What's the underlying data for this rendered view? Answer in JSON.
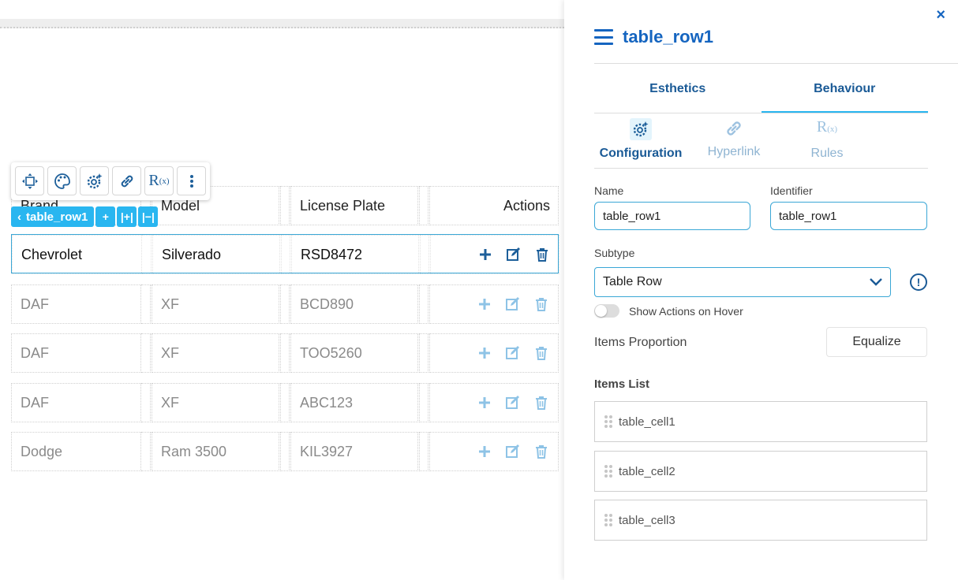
{
  "table": {
    "headers": [
      "Brand",
      "Model",
      "License Plate",
      "Actions"
    ],
    "rows": [
      {
        "brand": "Chevrolet",
        "model": "Silverado",
        "plate": "RSD8472"
      },
      {
        "brand": "DAF",
        "model": "XF",
        "plate": "BCD890"
      },
      {
        "brand": "DAF",
        "model": "XF",
        "plate": "TOO5260"
      },
      {
        "brand": "DAF",
        "model": "XF",
        "plate": "ABC123"
      },
      {
        "brand": "Dodge",
        "model": "Ram 3500",
        "plate": "KIL3927"
      }
    ]
  },
  "floating_toolbar": {
    "icons": [
      "move-icon",
      "palette-icon",
      "settings-sparkle-icon",
      "link-icon",
      "rules-icon",
      "more-vertical-icon"
    ],
    "rules_glyph": "R",
    "rules_sub": "(x)"
  },
  "selection_tag": {
    "back": "‹",
    "label": "table_row1",
    "add": "+",
    "insert": "|+|",
    "remove": "|−|"
  },
  "panel": {
    "close": "×",
    "title": "table_row1",
    "tabs": [
      "Esthetics",
      "Behaviour"
    ],
    "subtabs": [
      "Configuration",
      "Hyperlink",
      "Rules"
    ],
    "name_label": "Name",
    "name_value": "table_row1",
    "identifier_label": "Identifier",
    "identifier_value": "table_row1",
    "subtype_label": "Subtype",
    "subtype_value": "Table Row",
    "info": "!",
    "show_actions_label": "Show Actions on Hover",
    "items_proportion_label": "Items Proportion",
    "equalize_label": "Equalize",
    "items_list_label": "Items List",
    "items": [
      "table_cell1",
      "table_cell2",
      "table_cell3"
    ]
  },
  "colors": {
    "accent": "#29b6f0",
    "primary": "#1565c0",
    "action_active": "#1d5f9a",
    "action_dim": "#8ec3e6"
  }
}
